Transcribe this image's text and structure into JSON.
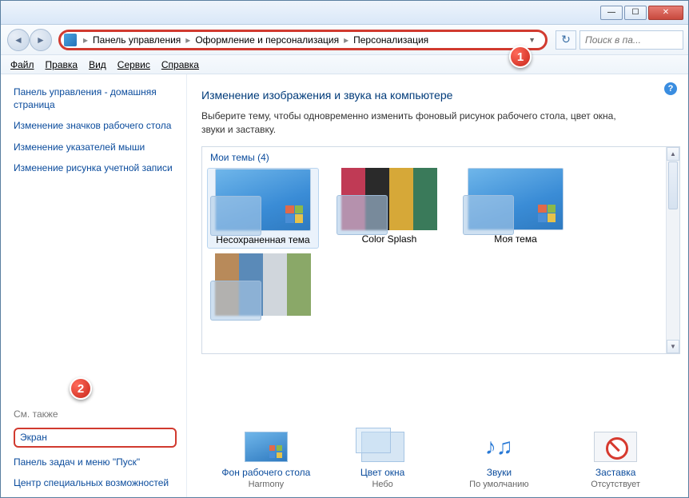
{
  "titlebar": {
    "min_tip": "Свернуть",
    "max_tip": "Развернуть",
    "close_tip": "Закрыть"
  },
  "nav": {
    "back_tip": "Назад",
    "fwd_tip": "Вперёд",
    "crumbs": [
      "Панель управления",
      "Оформление и персонализация",
      "Персонализация"
    ],
    "refresh_tip": "Обновить",
    "search_placeholder": "Поиск в па..."
  },
  "menu": [
    "Файл",
    "Правка",
    "Вид",
    "Сервис",
    "Справка"
  ],
  "sidebar": {
    "home": "Панель управления - домашняя страница",
    "links": [
      "Изменение значков рабочего стола",
      "Изменение указателей мыши",
      "Изменение рисунка учетной записи"
    ],
    "seealso_label": "См. также",
    "screen": "Экран",
    "taskbar": "Панель задач и меню \"Пуск\"",
    "accessibility": "Центр специальных возможностей"
  },
  "content": {
    "help_tip": "Справка",
    "heading": "Изменение изображения и звука на компьютере",
    "desc": "Выберите тему, чтобы одновременно изменить фоновый рисунок рабочего стола, цвет окна, звуки и заставку.",
    "mythemes_label": "Мои темы (4)",
    "themes": [
      {
        "name": "Несохраненная тема",
        "selected": true,
        "kind": "win7"
      },
      {
        "name": "Color Splash",
        "selected": false,
        "kind": "splash"
      },
      {
        "name": "Моя тема",
        "selected": false,
        "kind": "win7"
      },
      {
        "name": "",
        "selected": false,
        "kind": "photos"
      }
    ],
    "settings": [
      {
        "label": "Фон рабочего стола",
        "value": "Harmony"
      },
      {
        "label": "Цвет окна",
        "value": "Небо"
      },
      {
        "label": "Звуки",
        "value": "По умолчанию"
      },
      {
        "label": "Заставка",
        "value": "Отсутствует"
      }
    ]
  },
  "annotations": {
    "b1": "1",
    "b2": "2"
  }
}
